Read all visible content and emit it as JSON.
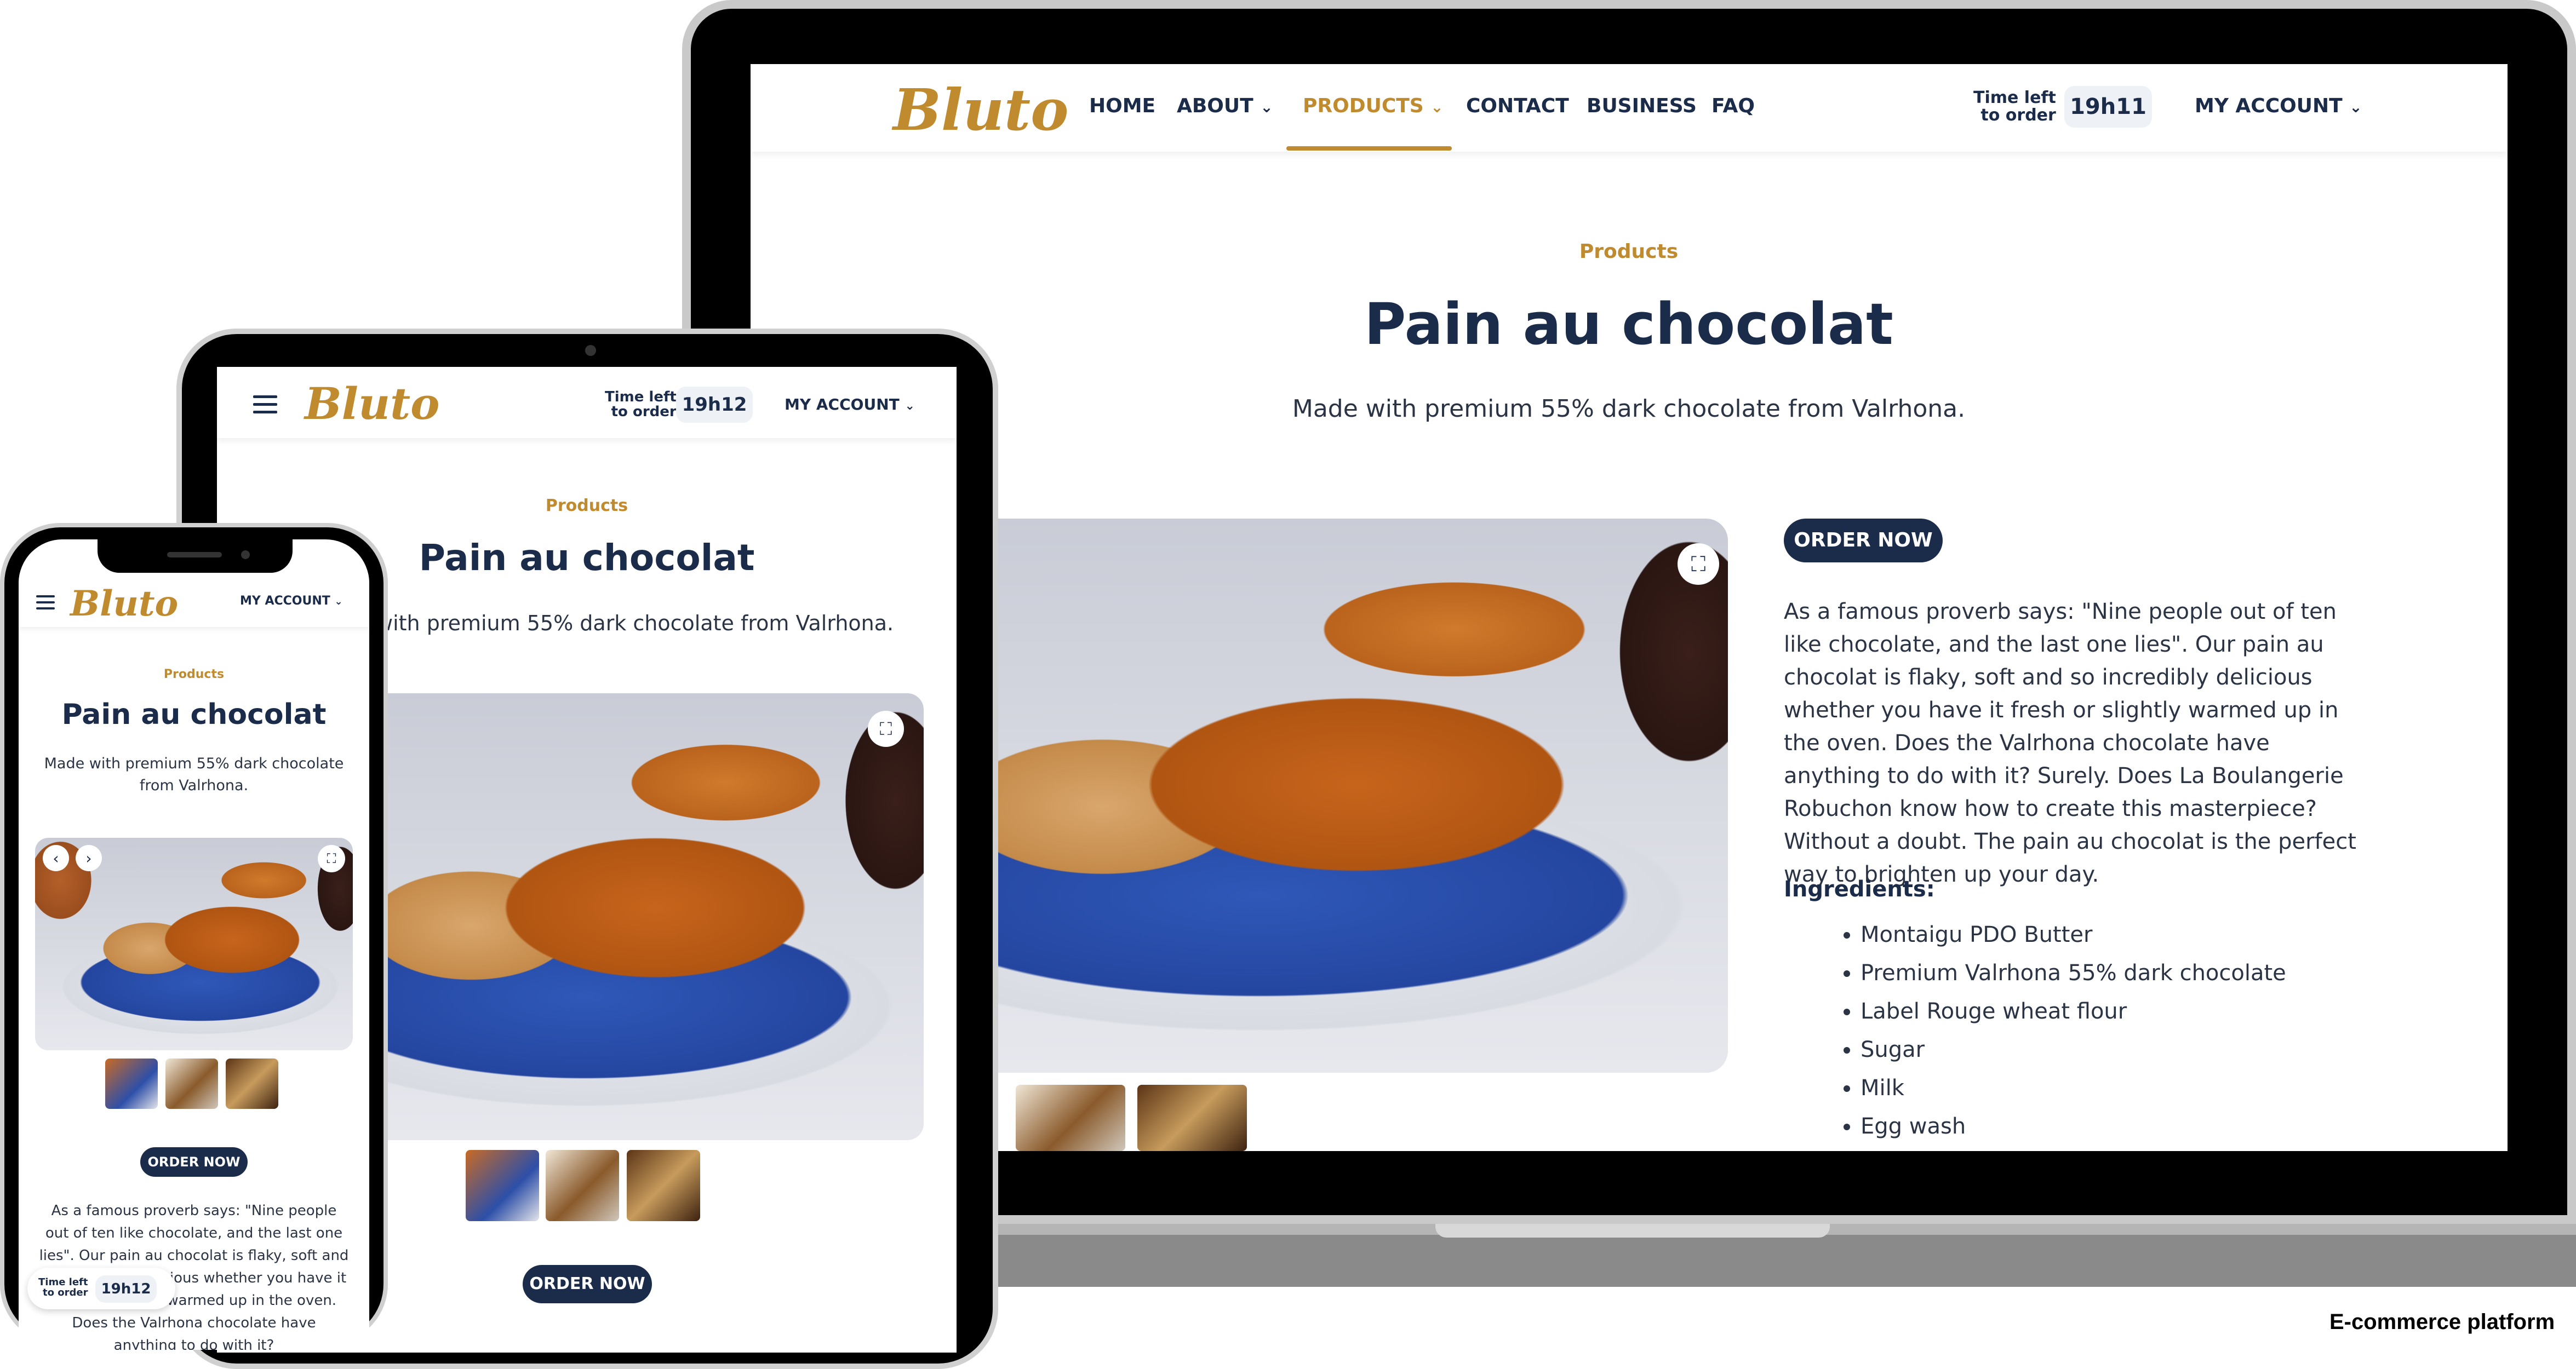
{
  "brand": {
    "logo_text": "Bluto",
    "accent": "#c08a2e",
    "navy": "#1b2b4a"
  },
  "laptop": {
    "nav": {
      "home": "HOME",
      "about": "ABOUT",
      "products": "PRODUCTS",
      "contact": "CONTACT",
      "business": "BUSINESS",
      "faq": "FAQ",
      "time_left_line1": "Time left",
      "time_left_line2": "to order",
      "timer": "19h11",
      "account": "MY ACCOUNT"
    },
    "breadcrumb": "Products",
    "title": "Pain au chocolat",
    "subtitle": "Made with premium 55% dark chocolate from Valrhona.",
    "order_button": "ORDER NOW",
    "description": "As a famous proverb says: \"Nine people out of ten like chocolate, and the last one lies\". Our pain au chocolat is flaky, soft and so incredibly delicious whether you have it fresh or slightly warmed up in the oven. Does the Valrhona chocolate have anything to do with it? Surely. Does La Boulangerie Robuchon know how to create this masterpiece? Without a doubt. The pain au chocolat is the perfect way to brighten up your day.",
    "ingredients_label": "Ingredients:",
    "ingredients": [
      "Montaigu PDO Butter",
      "Premium Valrhona 55% dark chocolate",
      "Label Rouge wheat flour",
      "Sugar",
      "Milk",
      "Egg wash"
    ]
  },
  "tablet": {
    "time_left_line1": "Time left",
    "time_left_line2": "to order",
    "timer": "19h12",
    "account": "MY ACCOUNT",
    "breadcrumb": "Products",
    "title": "Pain au chocolat",
    "subtitle": "with premium 55% dark chocolate from Valrhona.",
    "order_button": "ORDER NOW"
  },
  "phone": {
    "account": "MY ACCOUNT",
    "breadcrumb": "Products",
    "title": "Pain au chocolat",
    "subtitle": "Made with premium 55% dark chocolate from Valrhona.",
    "order_button": "ORDER NOW",
    "description": "As a famous proverb says: \"Nine people out of ten like chocolate, and the last one lies\". Our pain au chocolat is flaky, soft and so incredibly delicious whether you have it fresh or slightly warmed up in the oven. Does the Valrhona chocolate have anything to do with it?",
    "time_left_line1": "Time left",
    "time_left_line2": "to order",
    "timer": "19h12"
  },
  "caption": "E-commerce platform",
  "icons": {
    "chevron": "chevron-down-icon",
    "fullscreen": "fullscreen-icon",
    "menu": "hamburger-menu-icon",
    "prev": "chevron-left-icon",
    "next": "chevron-right-icon"
  }
}
